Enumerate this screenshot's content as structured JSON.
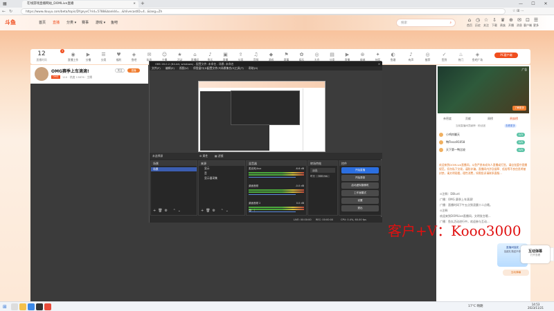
{
  "browser": {
    "tab_title": "在线游戏直播网站_DOMLive直播",
    "url": "https://www.douyu.com/beta/topic/DYgnyvC?rid=5788&bankId=...&hlivecastID=4...&lang=Zh",
    "controls": [
      "—",
      "☐",
      "✕"
    ]
  },
  "site": {
    "logo": "斗鱼",
    "nav": [
      "首页",
      "直播",
      "分类 ▾",
      "赛事",
      "游戏 ▾",
      "鱼吧"
    ],
    "search_placeholder": "搜索",
    "top_icons": [
      {
        "g": "⌂",
        "l": "首页"
      },
      {
        "g": "◷",
        "l": "历史"
      },
      {
        "g": "☆",
        "l": "关注"
      },
      {
        "g": "⇩",
        "l": "下载"
      },
      {
        "g": "♛",
        "l": "贵族"
      },
      {
        "g": "⊕",
        "l": "开播"
      },
      {
        "g": "✉",
        "l": "消息"
      },
      {
        "g": "⊡",
        "l": "客户端"
      },
      {
        "g": "☰",
        "l": "更多"
      }
    ]
  },
  "category_bar": {
    "date_day": "12",
    "date_label": "直播时间",
    "badge": "3",
    "categories": [
      "直播工作",
      "分播",
      "分类",
      "福利",
      "鱼吧",
      "私信",
      "主播",
      "活动",
      "直播间",
      "鱼乐",
      "直播",
      "分享",
      "音频",
      "游戏",
      "赛事",
      "娱乐",
      "大会",
      "分类",
      "直播",
      "商城",
      "抽奖",
      "鱼塘"
    ],
    "right_items": [
      "有声",
      "推荐",
      "签到",
      "热门",
      "鱼吧广场"
    ],
    "pc_button": "PC客户端"
  },
  "room": {
    "title": "OMG赛季上车滴滴!",
    "follow": "关注",
    "live_tag": "直播",
    "meta": "110 · 热度 13876 · 主播",
    "tag": "OMG"
  },
  "obs": {
    "title": "OBS 28.0.2 (64-bit, windows) - 配置文件: 未命名 - 场景: 未命名",
    "menu": [
      "文件(F)",
      "编辑(E)",
      "视图(V)",
      "停靠窗口(D)",
      "配置文件(P)",
      "场景集合(S)",
      "工具(T)",
      "帮助(H)"
    ],
    "preview_tabs": [
      "属性",
      "滤镜"
    ],
    "scene_label": "未选择源",
    "panes": {
      "scenes": "场景",
      "sources": "来源",
      "mixer": "混音器",
      "transitions": "转场特效",
      "controls": "控件"
    },
    "scene_item": "场景",
    "sources": [
      "显示",
      "音",
      "显示器采集"
    ],
    "mixer": [
      {
        "name": "麦克风/Aux",
        "db": "-6.6 dB"
      },
      {
        "name": "桌面音频",
        "db": "-0.0 dB"
      },
      {
        "name": "桌面音频 2",
        "db": "0.0 dB"
      }
    ],
    "transition": {
      "value": "淡出",
      "duration_label": "时长",
      "duration": "300 ms"
    },
    "controls": [
      "开始直播",
      "开始录制",
      "启动虚拟摄像机",
      "工作室模式",
      "设置",
      "退出"
    ],
    "status": {
      "live": "LIVE: 00:00:00",
      "rec": "REC: 00:00:00",
      "cpu": "CPU: 0.4%, 60.00 fps"
    }
  },
  "sidebar": {
    "ad": "广告",
    "ad_btn": "了解更多",
    "tabs": [
      "亲密度",
      "贡献",
      "周榜",
      "贵族榜"
    ],
    "tabs_active": "贵族榜",
    "rank_title": "当前直播间贡献榜 · 粉丝团",
    "rank_btn": "查看更多",
    "ranks": [
      {
        "name": "小鸡炸翻天",
        "lv": "LV3"
      },
      {
        "name": "鸭Fleco91058",
        "lv": "LV5"
      },
      {
        "name": "天下第一鸭比较",
        "lv": "LV5"
      }
    ],
    "notice": "欢迎来到DOMLive直播间，斗鱼严禁未成年人直播或打赏。请自觉遵守直播规范，切勿私下交易，谨防诈骗。直播间内涉及烟草、低俗等不良信息将被封禁，请文明观看，理性消费，如需投诉请联系客服...",
    "chat": [
      "⊙注释：DBlunt",
      "广播：OMG 赛季上车滴滴!",
      "广播：直播时间下午五点到凌晨十二点哦。",
      "⊙注释",
      "欢迎来到DOMLive直播间，文明发言哦...",
      "广播：鱼丸活动进行中，欢迎参与互动..."
    ],
    "promo_title": "直播间抽奖",
    "promo_sub": "抽奖礼物送不停",
    "gift_btn": "互动弹幕",
    "gift_sub": "打开查看"
  },
  "watermark": "客户+V：Kooo3000",
  "taskbar": {
    "weather": "17°C 晴朗",
    "time": "14:53",
    "date": "2023/11/21"
  }
}
